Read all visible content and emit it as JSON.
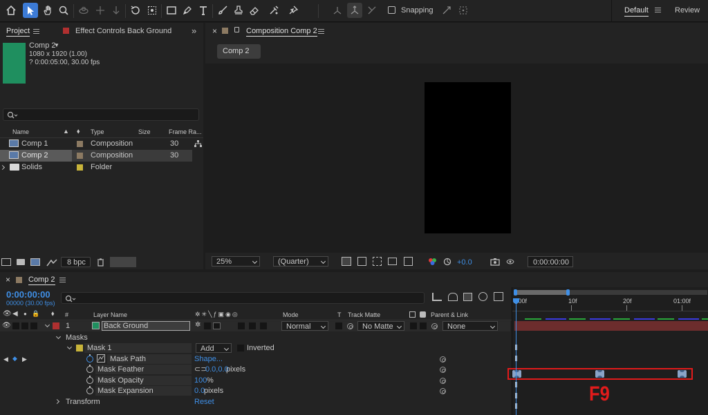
{
  "toolbar": {
    "snapping_label": "Snapping",
    "workspace_default": "Default",
    "workspace_review": "Review"
  },
  "project_panel": {
    "tab_project": "Project",
    "tab_effect_controls": "Effect Controls Back Ground",
    "effect_controls_color": "#b03030",
    "thumbnail_color": "#1f8f5f",
    "comp_name": "Comp 2",
    "comp_resolution": "1080 x 1920 (1.00)",
    "comp_duration": "? 0:00:05:00, 30.00 fps",
    "columns": {
      "name": "Name",
      "type": "Type",
      "size": "Size",
      "frame_rate": "Frame Ra..."
    },
    "items": [
      {
        "name": "Comp 1",
        "type": "Composition",
        "frame_rate": "30",
        "label_color": "#8c7a62"
      },
      {
        "name": "Comp 2",
        "type": "Composition",
        "frame_rate": "30",
        "label_color": "#8c7a62"
      },
      {
        "name": "Solids",
        "type": "Folder",
        "frame_rate": "",
        "label_color": "#c8b43a"
      }
    ],
    "bpc_label": "8 bpc"
  },
  "composition_panel": {
    "tab_title": "Composition Comp 2",
    "tab_swatch_color": "#8c7a62",
    "breadcrumb": "Comp 2",
    "zoom": "25%",
    "resolution": "(Quarter)",
    "exposure": "+0.0",
    "timecode": "0:00:00:00"
  },
  "timeline": {
    "tab_title": "Comp 2",
    "current_time": "0:00:00:00",
    "fps_label": "00000 (30.00 fps)",
    "columns": {
      "layer_name": "Layer Name",
      "mode": "Mode",
      "t": "T",
      "track_matte": "Track Matte",
      "parent_link": "Parent & Link"
    },
    "ruler_labels": [
      "0:00f",
      "10f",
      "20f",
      "01:00f"
    ],
    "layer": {
      "index": "1",
      "name": "Back Ground",
      "color": "#1f8f5f",
      "label_color": "#b03030",
      "mode": "Normal",
      "track_matte": "No Matte",
      "parent": "None"
    },
    "masks_label": "Masks",
    "mask": {
      "name": "Mask 1",
      "mode": "Add",
      "inverted_label": "Inverted",
      "color": "#c8b43a"
    },
    "properties": [
      {
        "name": "Mask Path",
        "value": "Shape...",
        "unit": ""
      },
      {
        "name": "Mask Feather",
        "value": "0.0,0.0",
        "unit": " pixels"
      },
      {
        "name": "Mask Opacity",
        "value": "100",
        "unit": "%"
      },
      {
        "name": "Mask Expansion",
        "value": "0.0",
        "unit": " pixels"
      }
    ],
    "transform_label": "Transform",
    "transform_value": "Reset",
    "annotation": "F9",
    "annotation_color": "#e21b1b"
  }
}
